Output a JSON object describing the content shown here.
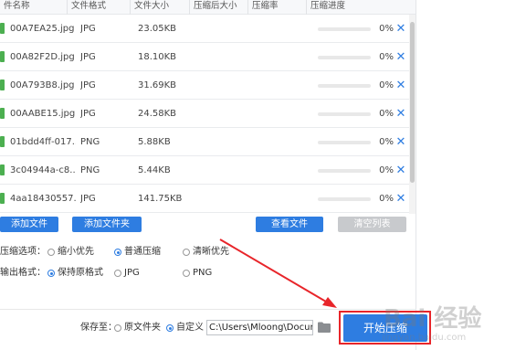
{
  "columns": [
    "件名称",
    "文件格式",
    "文件大小",
    "压缩后大小",
    "压缩率",
    "压缩进度"
  ],
  "files": [
    {
      "name": "00A7EA25.jpg",
      "format": "JPG",
      "size": "23.05KB",
      "compressed": "",
      "ratio": "",
      "progress": 0,
      "progress_text": "0%",
      "delete": "✕"
    },
    {
      "name": "00A82F2D.jpg",
      "format": "JPG",
      "size": "18.10KB",
      "compressed": "",
      "ratio": "",
      "progress": 0,
      "progress_text": "0%",
      "delete": "✕"
    },
    {
      "name": "00A793B8.jpg",
      "format": "JPG",
      "size": "31.69KB",
      "compressed": "",
      "ratio": "",
      "progress": 0,
      "progress_text": "0%",
      "delete": "✕"
    },
    {
      "name": "00AABE15.jpg",
      "format": "JPG",
      "size": "24.58KB",
      "compressed": "",
      "ratio": "",
      "progress": 0,
      "progress_text": "0%",
      "delete": "✕"
    },
    {
      "name": "01bdd4ff-017...",
      "format": "PNG",
      "size": "5.88KB",
      "compressed": "",
      "ratio": "",
      "progress": 0,
      "progress_text": "0%",
      "delete": "✕"
    },
    {
      "name": "3c04944a-c8...",
      "format": "PNG",
      "size": "5.44KB",
      "compressed": "",
      "ratio": "",
      "progress": 0,
      "progress_text": "0%",
      "delete": "✕"
    },
    {
      "name": "4aa18430557...",
      "format": "JPG",
      "size": "141.75KB",
      "compressed": "",
      "ratio": "",
      "progress": 0,
      "progress_text": "0%",
      "delete": "✕"
    }
  ],
  "buttons": {
    "add_file": "添加文件",
    "add_folder": "添加文件夹",
    "view_file": "查看文件",
    "clear_list": "清空列表",
    "start": "开始压缩"
  },
  "compress_options": {
    "label": "压缩选项：",
    "options": [
      "缩小优先",
      "普通压缩",
      "清晰优先"
    ],
    "selected": "普通压缩"
  },
  "output_format": {
    "label": "输出格式：",
    "options": [
      "保持原格式",
      "JPG",
      "PNG"
    ],
    "selected": "保持原格式"
  },
  "save_to": {
    "label": "保存至：",
    "options": [
      "原文件夹",
      "自定义"
    ],
    "selected": "自定义",
    "path": "C:\\Users\\Mloong\\Docume"
  },
  "icons": {
    "file": "file-image-icon",
    "delete": "close-icon",
    "folder": "folder-icon"
  },
  "colors": {
    "accent": "#2e7de1",
    "highlight": "#e8252a",
    "disabled": "#c8cacd"
  },
  "watermark": {
    "brand": "Bai  经验",
    "url": "jingyan.baidu.com"
  }
}
